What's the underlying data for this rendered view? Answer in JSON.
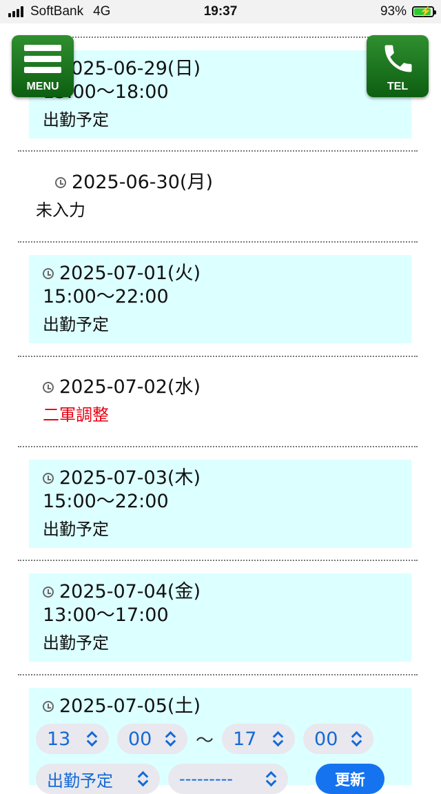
{
  "statusbar": {
    "carrier": "SoftBank",
    "network": "4G",
    "time": "19:37",
    "battery": "93%",
    "battery_level": 0.93
  },
  "buttons": {
    "menu_label": "MENU",
    "tel_label": "TEL"
  },
  "entries": [
    {
      "date": "2025-06-29(日)",
      "time": "13:00～18:00",
      "status": "出勤予定"
    },
    {
      "date": "2025-06-30(月)",
      "status": "未入力"
    },
    {
      "date": "2025-07-01(火)",
      "time": "15:00～22:00",
      "status": "出勤予定"
    },
    {
      "date": "2025-07-02(水)",
      "status": "二軍調整"
    },
    {
      "date": "2025-07-03(木)",
      "time": "15:00～22:00",
      "status": "出勤予定"
    },
    {
      "date": "2025-07-04(金)",
      "time": "13:00～17:00",
      "status": "出勤予定"
    },
    {
      "date": "2025-07-05(土)"
    }
  ],
  "editor": {
    "start_hour": "13",
    "start_min": "00",
    "separator": "～",
    "end_hour": "17",
    "end_min": "00",
    "status_select": "出勤予定",
    "extra_select": "---------",
    "update_label": "更新"
  },
  "colors": {
    "card_bg": "#dcffff",
    "accent_green": "#0d5e11",
    "status_red": "#e60012",
    "select_blue": "#1569d6",
    "button_blue": "#1573f0"
  }
}
